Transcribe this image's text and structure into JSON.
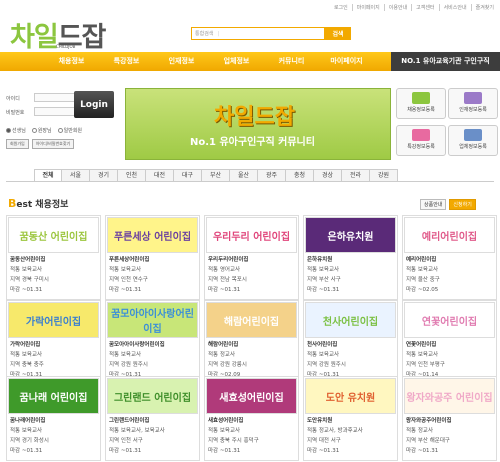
{
  "util": [
    "로그인",
    "마이페이지",
    "이용안내",
    "고객센터",
    "서비스안내",
    "즐겨찾기"
  ],
  "logo": {
    "main_a": "차일",
    "main_b": "드잡",
    "sub": "CHILDJOB"
  },
  "search": {
    "scope": "통합검색",
    "button": "검색"
  },
  "nav": [
    "채용정보",
    "특강정보",
    "인재정보",
    "업체정보",
    "커뮤니티",
    "마이페이지"
  ],
  "nav_right": "NO.1 유아교육기관 구인구직",
  "login": {
    "id_label": "아이디",
    "pw_label": "비밀번호",
    "button": "Login",
    "radios": [
      "선생님",
      "원장님",
      "일반회원"
    ],
    "join": "회원가입",
    "find": "아이디/비밀번호찾기"
  },
  "banner": {
    "title": "차일드잡",
    "sub": "No.1 유아구인구직 커뮤니티"
  },
  "quick": [
    "채용정보등록",
    "인재정보등록",
    "특강정보등록",
    "업체정보등록"
  ],
  "tabs": [
    "전체",
    "서울",
    "경기",
    "인천",
    "대전",
    "대구",
    "부산",
    "울산",
    "광주",
    "충청",
    "경상",
    "전라",
    "강원"
  ],
  "best": {
    "lead": "B",
    "rest": "est 채용정보",
    "btn_more": "상품안내",
    "btn_apply": "신청하기"
  },
  "cards": [
    {
      "img": "꿈동산 어린이집",
      "name": "꿈동산어린이집",
      "job": "적통  보육교사",
      "area": "지역  경북 구미시",
      "deadline": "마감  ~01.31",
      "bg": "#ffffff",
      "fg": "#9bc53d"
    },
    {
      "img": "푸른세상 어린이집",
      "name": "푸른세상어린이집",
      "job": "적통  보육교사",
      "area": "지역  인천 연수구",
      "deadline": "마감  ~01.31",
      "bg": "#fff48a",
      "fg": "#6a3fa0"
    },
    {
      "img": "우리두리 어린이집",
      "name": "우리두리어린이집",
      "job": "적통  영어교사",
      "area": "지역  전남 목포시",
      "deadline": "마감  ~01.31",
      "bg": "#ffffff",
      "fg": "#e0457b"
    },
    {
      "img": "은하유치원",
      "name": "은하유치원",
      "job": "적통  보육교사",
      "area": "지역  부산 사구",
      "deadline": "마감  ~01.31",
      "bg": "#5a2a78",
      "fg": "#ffffff"
    },
    {
      "img": "예리어린이집",
      "name": "예리어린이집",
      "job": "적통  보육교사",
      "area": "지역  울산 중구",
      "deadline": "마감  ~02.05",
      "bg": "#ffffff",
      "fg": "#e05a8a"
    },
    {
      "img": "가락어린이집",
      "name": "가락어린이집",
      "job": "적통  보육교사",
      "area": "지역  충북 충주",
      "deadline": "마감  ~01.31",
      "bg": "#f7e96b",
      "fg": "#3a7fd0"
    },
    {
      "img": "꿈모아아이사랑어린이집",
      "name": "꿈모아아이사랑어린이집",
      "job": "적통  보육교사",
      "area": "지역  강원 원주시",
      "deadline": "마감  ~01.31",
      "bg": "#c8e678",
      "fg": "#3a8fd8"
    },
    {
      "img": "해람어린이집",
      "name": "해람어린이집",
      "job": "적통  정교사",
      "area": "지역  강원 강릉시",
      "deadline": "마감  ~02.09",
      "bg": "#f4d28a",
      "fg": "#ffffff"
    },
    {
      "img": "천사어린이집",
      "name": "천사어린이집",
      "job": "적통  보육교사",
      "area": "지역  강원 원주시",
      "deadline": "마감  ~01.31",
      "bg": "#eaf3ff",
      "fg": "#7bc043"
    },
    {
      "img": "연꽃어린이집",
      "name": "연꽃어린이집",
      "job": "적통  보육교사",
      "area": "지역  인천 부평구",
      "deadline": "마감  ~01.14",
      "bg": "#ffffff",
      "fg": "#e07bb0"
    },
    {
      "img": "꿈나래 어린이집",
      "name": "꿈나래어린이집",
      "job": "적통  보육교사",
      "area": "지역  경기 화성시",
      "deadline": "마감  ~01.31",
      "bg": "#ffffff",
      "fg": "#ffffff"
    },
    {
      "img": "그린랜드 어린이집",
      "name": "그린랜드어린이집",
      "job": "적통  보육교사, 보육교사",
      "area": "지역  인천 서구",
      "deadline": "마감  ~01.31",
      "bg": "#d8f2b0",
      "fg": "#3f8f2a"
    },
    {
      "img": "새효성어린이집",
      "name": "새효성어린이집",
      "job": "적통  보육교사",
      "area": "지역  충북 주시 흥덕구",
      "deadline": "마감  ~01.31",
      "bg": "#b03a7a",
      "fg": "#ffffff"
    },
    {
      "img": "도안 유치원",
      "name": "도안유치원",
      "job": "적통  정교사, 방과후교사",
      "area": "지역  대전 서구",
      "deadline": "마감  ~01.31",
      "bg": "#fff7c0",
      "fg": "#e06030"
    },
    {
      "img": "왕자와공주 어린이집",
      "name": "왕자와공주어린이집",
      "job": "적통  정교사",
      "area": "지역  부산 해운대구",
      "deadline": "마감  ~01.31",
      "bg": "#fff6e8",
      "fg": "#f0a9c8"
    }
  ],
  "colors": {
    "accent": "#f2a900",
    "green": "#8cc63f",
    "dark": "#3d3d3d"
  }
}
